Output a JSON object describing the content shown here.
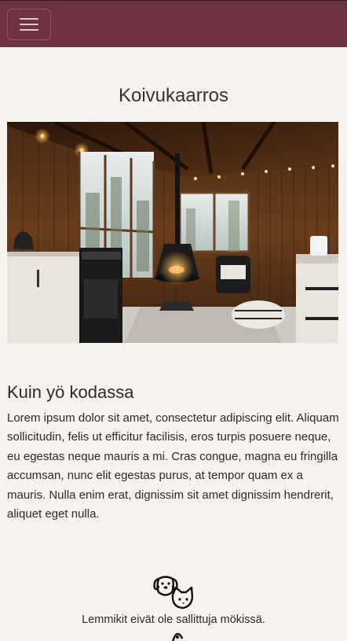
{
  "navbar": {
    "background": "#6e3340",
    "menu_icon": "hamburger-menu-icon"
  },
  "page": {
    "title": "Koivukaarros"
  },
  "hero_image": {
    "description_icon": "cabin-interior-photo"
  },
  "section": {
    "title": "Kuin yö kodassa",
    "body": "Lorem ipsum dolor sit amet, consectetur adipiscing elit. Aliquam sollicitudin, felis ut efficitur facilisis, eros turpis posuere neque, eu egestas neque mauris a mi. Cras congue, magna eu fringilla accumsan, nunc elit egestas purus, at tempor quam ex a mauris. Nulla enim erat, dignissim sit amet dignissim hendrerit, aliquet eget nulla."
  },
  "features": [
    {
      "icon": "dog-and-cat-icon",
      "text": "Lemmikit eivät ole sallittuja mökissä."
    }
  ]
}
